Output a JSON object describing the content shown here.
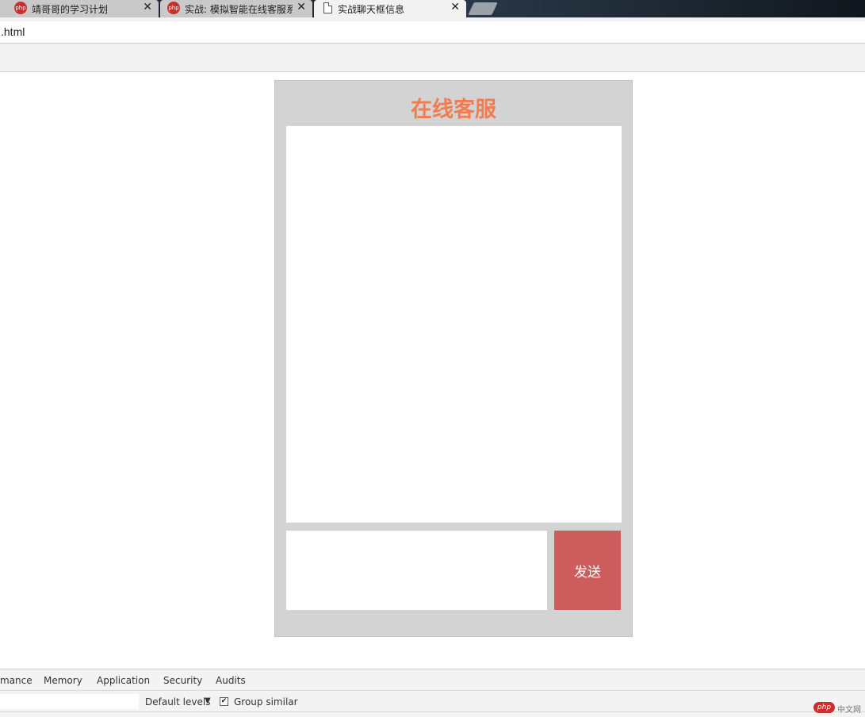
{
  "browser": {
    "tabs": [
      {
        "title": "靖哥哥的学习计划",
        "favicon": "php-icon",
        "close": "✕"
      },
      {
        "title": "实战: 模拟智能在线客服系",
        "favicon": "php-icon",
        "close": "✕"
      },
      {
        "title": "实战聊天框信息",
        "favicon": "document-icon",
        "close": "✕"
      }
    ],
    "favicon_text": "php",
    "url": ".html"
  },
  "chat": {
    "title": "在线客服",
    "send_label": "发送",
    "input_value": "",
    "colors": {
      "title": "#f27c52",
      "send": "#cd5c5c",
      "panel": "#d3d3d3"
    }
  },
  "devtools": {
    "tabs": [
      "mance",
      "Memory",
      "Application",
      "Security",
      "Audits"
    ],
    "levels_label": "Default levels",
    "levels_arrow": "▼",
    "group_similar_label": "Group similar",
    "group_similar_checked": "✔"
  },
  "watermark": {
    "logo": "php",
    "text": "中文网"
  }
}
